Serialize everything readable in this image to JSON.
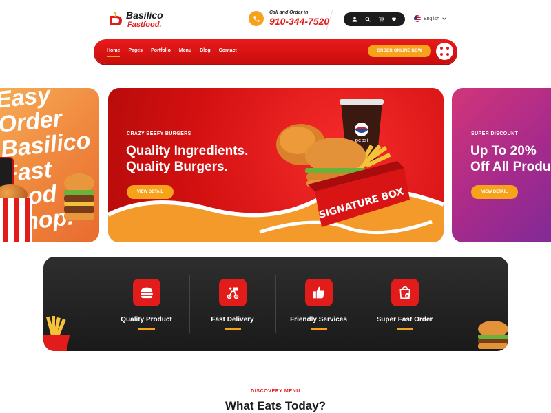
{
  "header": {
    "logo": {
      "line1": "Basilico",
      "line2": "Fastfood."
    },
    "call": {
      "label": "Call and Order in",
      "phone": "910-344-7520"
    },
    "icons": [
      "user-icon",
      "search-icon",
      "cart-icon",
      "heart-icon"
    ],
    "language": "English"
  },
  "nav": {
    "links": [
      "Home",
      "Pages",
      "Portfolio",
      "Menu",
      "Blog",
      "Contact"
    ],
    "active": "Home",
    "order_button": "ORDER ONLINE NOW"
  },
  "slides": {
    "left": {
      "lines": [
        "Easy",
        "Order",
        "Basilico",
        "Fast food",
        "Shop."
      ]
    },
    "main": {
      "eyebrow": "CRAZY BEEFY BURGERS",
      "title_line1": "Quality Ingredients.",
      "title_line2": "Quality Burgers.",
      "button": "VIEW DETAIL",
      "box_label": "SIGNATURE BOX",
      "cup_label": "pepsi"
    },
    "right": {
      "eyebrow": "SUPER DISCOUNT",
      "title_line1": "Up To 20%",
      "title_line2": "Off All Products",
      "button": "VIEW DETAIL"
    }
  },
  "features": [
    {
      "label": "Quality Product",
      "icon": "burger-icon"
    },
    {
      "label": "Fast Delivery",
      "icon": "delivery-icon"
    },
    {
      "label": "Friendly Services",
      "icon": "thumbs-up-icon"
    },
    {
      "label": "Super Fast Order",
      "icon": "shopping-bag-icon"
    }
  ],
  "discovery": {
    "eyebrow": "DISCOVERY MENU",
    "title": "What Eats Today?"
  },
  "colors": {
    "brand_red": "#e21b1b",
    "accent_orange": "#f7a21b",
    "dark": "#1c1c1c",
    "purple": "#a52a8c"
  }
}
